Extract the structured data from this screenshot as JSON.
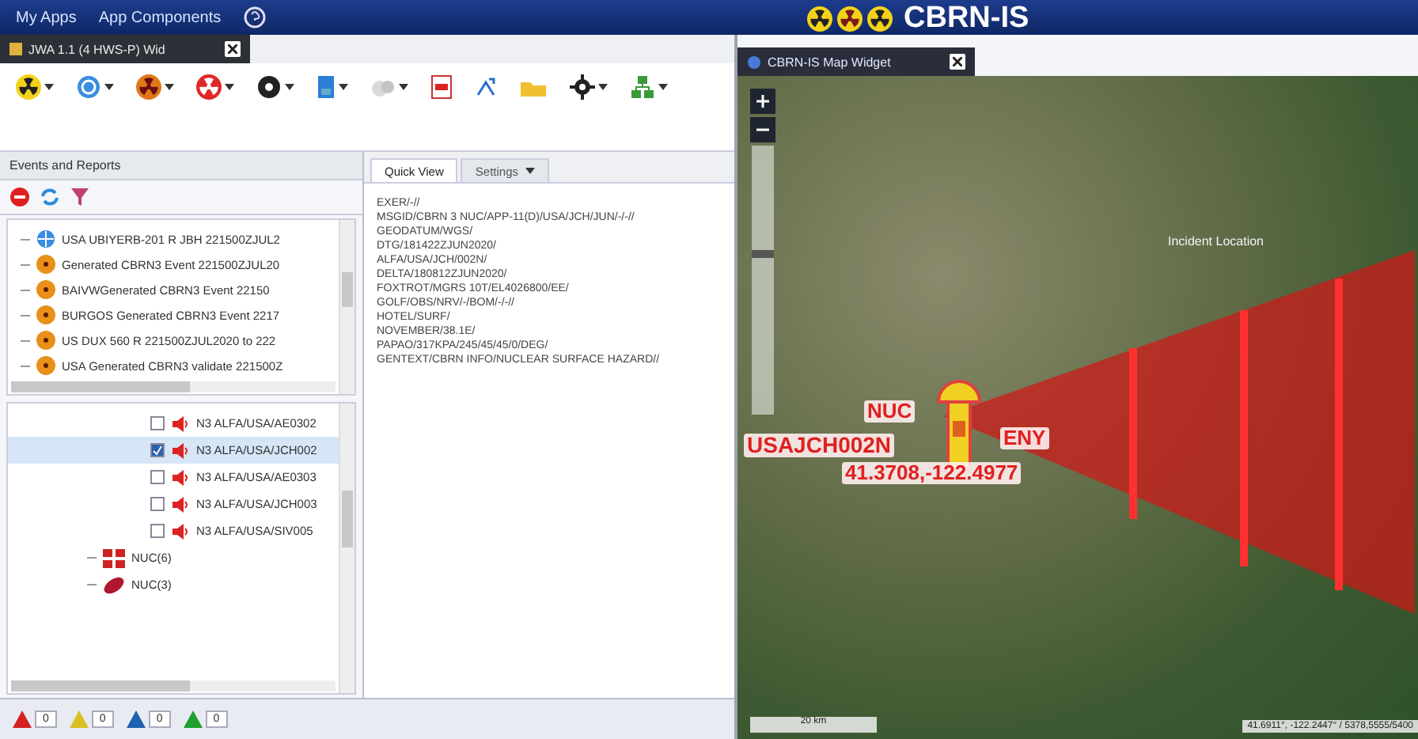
{
  "header": {
    "menu": [
      "My Apps",
      "App Components"
    ],
    "logo": "CBRN-IS"
  },
  "widget_tab": {
    "title": "JWA 1.1 (4 HWS-P) Wid"
  },
  "events_panel": {
    "title": "Events and Reports",
    "events": [
      {
        "kind": "report",
        "label": "USA UBIYERB-201 R JBH 221500ZJUL2"
      },
      {
        "kind": "event",
        "label": "Generated CBRN3 Event 221500ZJUL20"
      },
      {
        "kind": "event",
        "label": "BAIVWGenerated CBRN3 Event 22150"
      },
      {
        "kind": "event",
        "label": "BURGOS Generated CBRN3 Event 2217"
      },
      {
        "kind": "event",
        "label": "US DUX 560 R 221500ZJUL2020 to 222"
      },
      {
        "kind": "event",
        "label": "USA Generated CBRN3 validate 221500Z"
      }
    ],
    "messages": [
      {
        "label": "N3 ALFA/USA/AE0302",
        "checked": false,
        "selected": false
      },
      {
        "label": "N3 ALFA/USA/JCH002",
        "checked": true,
        "selected": true
      },
      {
        "label": "N3 ALFA/USA/AE0303",
        "checked": false,
        "selected": false
      },
      {
        "label": "N3 ALFA/USA/JCH003",
        "checked": false,
        "selected": false
      },
      {
        "label": "N3 ALFA/USA/SIV005",
        "checked": false,
        "selected": false
      }
    ],
    "groups": [
      {
        "kind": "grid",
        "label": "NUC(6)"
      },
      {
        "kind": "plume",
        "label": "NUC(3)"
      }
    ]
  },
  "quick_view": {
    "tabs": [
      {
        "label": "Quick View",
        "selected": true,
        "dropdown": false
      },
      {
        "label": "Settings",
        "selected": false,
        "dropdown": true
      }
    ],
    "lines": [
      "EXER/-//",
      "MSGID/CBRN 3 NUC/APP-11(D)/USA/JCH/JUN/-/-//",
      "GEODATUM/WGS/",
      "DTG/181422ZJUN2020/",
      "ALFA/USA/JCH/002N/",
      "DELTA/180812ZJUN2020/",
      "FOXTROT/MGRS 10T/EL4026800/EE/",
      "GOLF/OBS/NRV/-/BOM/-/-//",
      "HOTEL/SURF/",
      "NOVEMBER/38.1E/",
      "PAPAO/317KPA/245/45/45/0/DEG/",
      "GENTEXT/CBRN INFO/NUCLEAR SURFACE HAZARD//"
    ]
  },
  "alerts": [
    {
      "count": "0",
      "color": "#d42020"
    },
    {
      "count": "0",
      "color": "#d8c020"
    },
    {
      "count": "0",
      "color": "#2060b0"
    },
    {
      "count": "0",
      "color": "#20a030"
    }
  ],
  "map": {
    "tab": "CBRN-IS Map Widget",
    "zoom": {
      "level": 0.6
    },
    "incident_label": "Incident Location",
    "marker": {
      "type": "NUC",
      "id": "USAJCH002N",
      "affiliation": "ENY",
      "coords": "41.3708,-122.4977"
    },
    "scale": "20 km",
    "cursor": "41.6911°, -122.2447° / 5378,5555/5400"
  }
}
